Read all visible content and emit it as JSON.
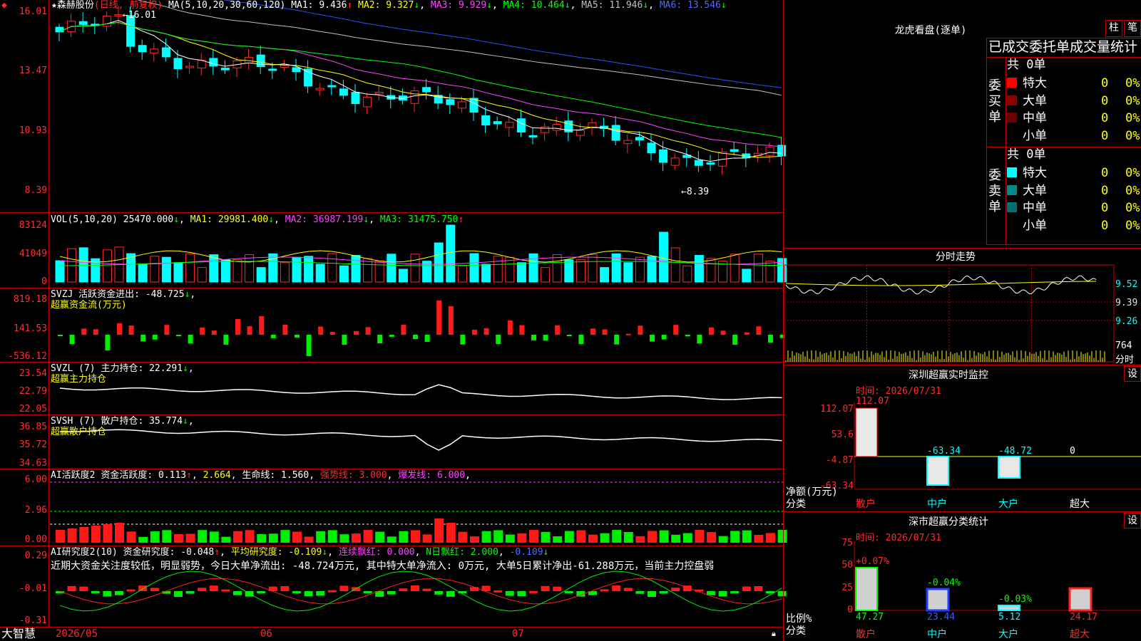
{
  "main": {
    "stock_name": "森赫股份",
    "period_label": "(日线, 前复权)",
    "ma_label": "MA(5,10,20,30,60,120)",
    "ma1": "MA1: 9.436",
    "ma2": "MA2: 9.327",
    "ma3": "MA3: 9.929",
    "ma4": "MA4: 10.464",
    "ma5": "MA5: 11.946",
    "ma6": "MA6: 13.546",
    "axis": [
      "16.01",
      "13.47",
      "10.93",
      "8.39"
    ],
    "high_mark": "16.01",
    "low_mark": "8.39",
    "colors": {
      "up": "#ff2a2a",
      "down": "#00ffff",
      "ma1": "#ffffff",
      "ma2": "#ffff00",
      "ma3": "#ff44ff",
      "ma4": "#00ff00",
      "ma5": "#c0c0c0",
      "ma6": "#3050ff"
    }
  },
  "volume": {
    "label": "VOL(5,10,20)",
    "value": "25470.000",
    "ma1": "MA1: 29981.400",
    "ma2": "MA2: 36987.199",
    "ma3": "MA3: 31475.750",
    "axis": [
      "83124",
      "41049",
      "0"
    ]
  },
  "svzj": {
    "label": "SVZJ",
    "desc": "活跃资金进出: -48.725",
    "sub": "超赢资金流(万元)",
    "axis": [
      "819.18",
      "141.53",
      "-536.12"
    ]
  },
  "svzl": {
    "label": "SVZL (7)",
    "desc": "主力持仓: 22.291",
    "sub": "超赢主力持仓",
    "axis": [
      "23.54",
      "22.79",
      "22.05"
    ]
  },
  "svsh": {
    "label": "SVSH (7)",
    "desc": "散户持仓: 35.774",
    "sub": "超赢散户持仓",
    "axis": [
      "36.85",
      "35.72",
      "34.63"
    ]
  },
  "ai_active": {
    "label": "AI活跃度2",
    "desc": "资金活跃度: 0.113",
    "v2": "2.664",
    "life": "生命线: 1.560",
    "strong": "强势线: 3.000",
    "burst": "爆发线: 6.000",
    "axis": [
      "6.00",
      "2.96",
      "0.00"
    ]
  },
  "ai_research": {
    "label": "AI研究度2(10)",
    "desc": "资金研究度: -0.048",
    "avg": "平均研究度: -0.109",
    "cont": "连续飘红: 0.000",
    "nday": "N日飘红: 2.000",
    "last": "-0.109",
    "comment": "近期大资金关注度较低，明显弱势，今日大单净流出: -48.724万元, 其中特大单净流入: 0万元, 大单5日累计净出-61.288万元，当前主力控盘弱",
    "axis": [
      "0.29",
      "-0.01",
      "-0.31"
    ]
  },
  "footer": {
    "brand": "大智慧",
    "dates": [
      "2026/05",
      "06",
      "07"
    ]
  },
  "right": {
    "lhb_title": "龙虎看盘(逐单)",
    "btn_zhu": "柱",
    "btn_bi": "笔",
    "order_header": "已成交委托单成交量统计",
    "buy_label": "委买单",
    "sell_label": "委卖单",
    "buy_total": "共 0单",
    "sell_total": "共 0单",
    "buy_rows": [
      {
        "name": "特大",
        "count": "0",
        "pct": "0%",
        "color": "#ff0000"
      },
      {
        "name": "大单",
        "count": "0",
        "pct": "0%",
        "color": "#8b0000"
      },
      {
        "name": "中单",
        "count": "0",
        "pct": "0%",
        "color": "#6b0000"
      },
      {
        "name": "小单",
        "count": "0",
        "pct": "0%",
        "color": "#000000"
      }
    ],
    "sell_rows": [
      {
        "name": "特大",
        "count": "0",
        "pct": "0%",
        "color": "#00ffff"
      },
      {
        "name": "大单",
        "count": "0",
        "pct": "0%",
        "color": "#008b8b"
      },
      {
        "name": "中单",
        "count": "0",
        "pct": "0%",
        "color": "#007070"
      },
      {
        "name": "小单",
        "count": "0",
        "pct": "0%",
        "color": "#000000"
      }
    ],
    "minute_title": "分时走势",
    "minute_axis": [
      "9.52",
      "9.39",
      "9.26",
      "764",
      "分时"
    ],
    "sz_title": "深圳超赢实时监控",
    "sz_time": "时间: 2026/07/31",
    "sz_btn": "设",
    "sz_axis": [
      "112.07",
      "53.6",
      "-4.87",
      "-63.34"
    ],
    "sz_vals": [
      "112.07",
      "-63.34",
      "-48.72",
      "0"
    ],
    "sz_unit": "净额(万元)",
    "sz_cat": "分类",
    "sz_cats": [
      "散户",
      "中户",
      "大户",
      "超大"
    ],
    "cls_title": "深市超赢分类统计",
    "cls_time": "时间: 2026/07/31",
    "cls_btn": "设",
    "cls_axis": [
      "75",
      "50",
      "25",
      "0"
    ],
    "cls_changes": [
      "+0.07%",
      "-0.04%",
      "-0.03%"
    ],
    "cls_vals": [
      "47.27",
      "23.44",
      "5.12",
      "24.17"
    ],
    "cls_unit": "比例%",
    "cls_cat": "分类",
    "cls_cats": [
      "散户",
      "中户",
      "大户",
      "超大"
    ]
  }
}
